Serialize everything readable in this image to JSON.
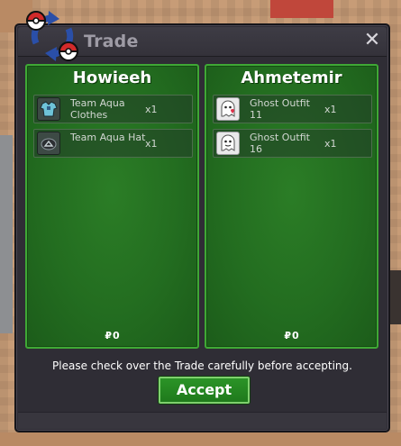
{
  "window": {
    "title": "Trade",
    "close_glyph": "✕"
  },
  "left_player": {
    "name": "Howieeh",
    "items": [
      {
        "name": "Team Aqua Clothes",
        "qty": "x1",
        "icon": "team-aqua-clothes-icon"
      },
      {
        "name": "Team Aqua Hat",
        "qty": "x1",
        "icon": "team-aqua-hat-icon"
      }
    ],
    "money_symbol": "₽",
    "money": "0"
  },
  "right_player": {
    "name": "Ahmetemir",
    "items": [
      {
        "name": "Ghost Outfit 11",
        "qty": "x1",
        "icon": "ghost-outfit-icon"
      },
      {
        "name": "Ghost Outfit 16",
        "qty": "x1",
        "icon": "ghost-outfit-icon"
      }
    ],
    "money_symbol": "₽",
    "money": "0"
  },
  "notice": "Please check over the Trade carefully before accepting.",
  "accept_label": "Accept",
  "colors": {
    "panel_green": "#236d20",
    "panel_border": "#3fa835",
    "window_bg": "#2f2d35",
    "accept_green": "#2b9427"
  }
}
